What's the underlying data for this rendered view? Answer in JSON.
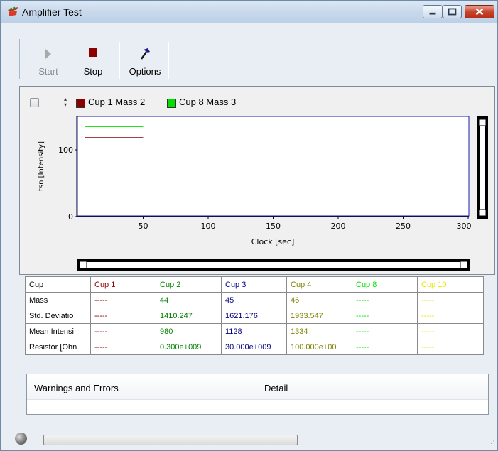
{
  "window": {
    "title": "Amplifier Test"
  },
  "toolbar": {
    "start_label": "Start",
    "stop_label": "Stop",
    "options_label": "Options"
  },
  "chart_data": {
    "type": "line",
    "title": "",
    "xlabel": "Clock [sec]",
    "ylabel": "tsn [Intensity]",
    "xlim": [
      0,
      300
    ],
    "ylim": [
      0,
      150
    ],
    "x_ticks": [
      "50",
      "100",
      "150",
      "200",
      "250",
      "300"
    ],
    "y_ticks": [
      "0",
      "100"
    ],
    "grid": false,
    "legend_position": "top-left",
    "series": [
      {
        "name": "Cup 1 Mass 2",
        "color": "#8b0000",
        "x": [
          5,
          50
        ],
        "y": [
          118,
          118
        ]
      },
      {
        "name": "Cup 8 Mass 3",
        "color": "#00e000",
        "x": [
          5,
          50
        ],
        "y": [
          135,
          135
        ]
      }
    ]
  },
  "table": {
    "columns": [
      {
        "label": "Cup",
        "color": "#000000"
      },
      {
        "label": "Cup 1",
        "color": "#8b0000"
      },
      {
        "label": "Cup 2",
        "color": "#008000"
      },
      {
        "label": "Cup 3",
        "color": "#000080"
      },
      {
        "label": "Cup 4",
        "color": "#808000"
      },
      {
        "label": "Cup 8",
        "color": "#00e000"
      },
      {
        "label": "Cup 10",
        "color": "#e6e600"
      }
    ],
    "rows": [
      {
        "label": "Mass",
        "values": [
          "-----",
          "44",
          "45",
          "46",
          "-----",
          "-----"
        ]
      },
      {
        "label": "Std. Deviatio",
        "values": [
          "-----",
          "1410.247",
          "1621.176",
          "1933.547",
          "-----",
          "-----"
        ]
      },
      {
        "label": "Mean Intensi",
        "values": [
          "-----",
          "980",
          "1128",
          "1334",
          "-----",
          "-----"
        ]
      },
      {
        "label": "Resistor [Ohn",
        "values": [
          "-----",
          "0.300e+009",
          "30.000e+009",
          "100.000e+00",
          "-----",
          "-----"
        ]
      }
    ]
  },
  "warnings": {
    "col1": "Warnings and Errors",
    "col2": "Detail"
  },
  "status": {
    "progress": 0
  }
}
